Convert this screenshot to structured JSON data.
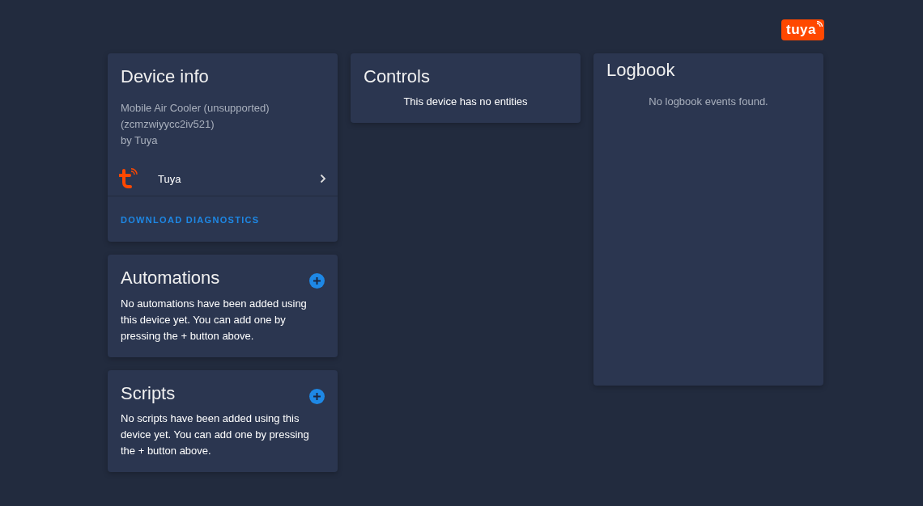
{
  "brand_logo": {
    "text": "tuya"
  },
  "device_info": {
    "title": "Device info",
    "lines": [
      "Mobile Air Cooler (unsupported)",
      "(zcmzwiyycc2iv521)",
      "by Tuya"
    ],
    "integration": "Tuya",
    "action": "DOWNLOAD DIAGNOSTICS"
  },
  "automations": {
    "title": "Automations",
    "message": "No automations have been added using this device yet. You can add one by pressing the + button above."
  },
  "scripts": {
    "title": "Scripts",
    "message": "No scripts have been added using this device yet. You can add one by pressing the + button above."
  },
  "controls": {
    "title": "Controls",
    "message": "This device has no entities"
  },
  "logbook": {
    "title": "Logbook",
    "message": "No logbook events found."
  }
}
